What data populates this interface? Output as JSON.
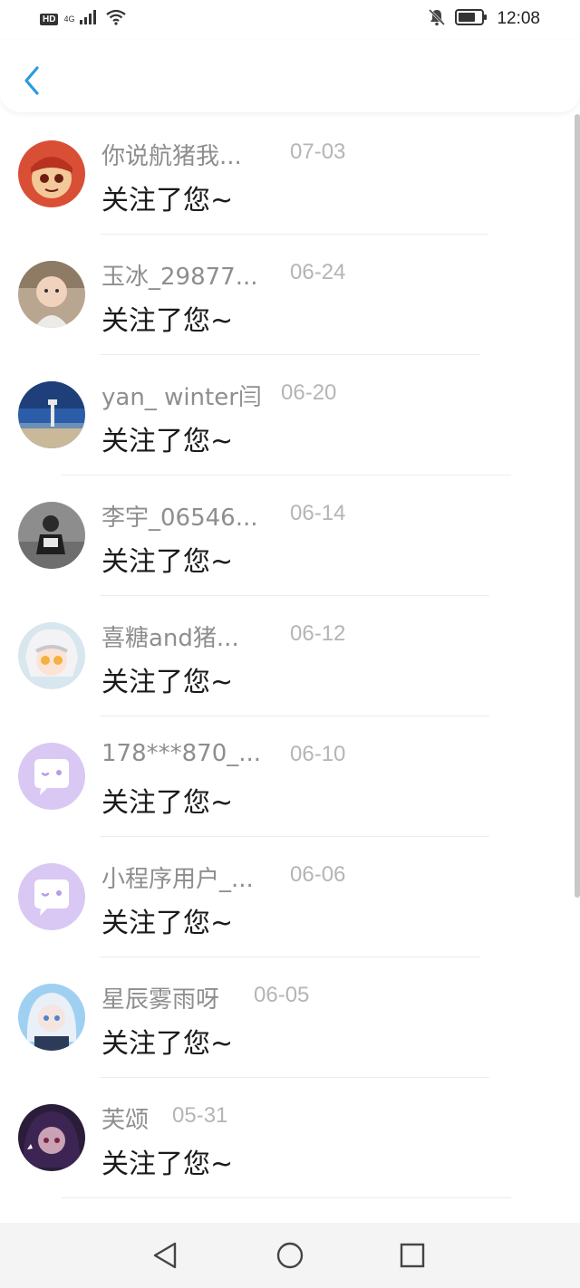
{
  "status_bar": {
    "hd": "HD",
    "network": "4G",
    "time": "12:08"
  },
  "header": {
    "back_icon": "chevron-left-icon",
    "accent": "#2a9ae0"
  },
  "notifications": [
    {
      "name": "你说航猪我...",
      "date": "07-03",
      "message": "关注了您~",
      "avatar": "cartoon-cat"
    },
    {
      "name": "玉冰_29877...",
      "date": "06-24",
      "message": "关注了您~",
      "avatar": "baby-photo"
    },
    {
      "name": "yan_ winter闫",
      "date": "06-20",
      "message": "关注了您~",
      "avatar": "lighthouse-sky"
    },
    {
      "name": "李宇_06546...",
      "date": "06-14",
      "message": "关注了您~",
      "avatar": "person-photo"
    },
    {
      "name": "喜糖and猪...",
      "date": "06-12",
      "message": "关注了您~",
      "avatar": "anime-girl"
    },
    {
      "name": "178***870_...",
      "date": "06-10",
      "message": "关注了您~",
      "avatar": "default-chat"
    },
    {
      "name": "小程序用户_...",
      "date": "06-06",
      "message": "关注了您~",
      "avatar": "default-chat"
    },
    {
      "name": "星辰雾雨呀",
      "date": "06-05",
      "message": "关注了您~",
      "avatar": "anime-blue"
    },
    {
      "name": "芙颂",
      "date": "05-31",
      "message": "关注了您~",
      "avatar": "dark-portrait"
    }
  ],
  "nav": {
    "back": "triangle-back-icon",
    "home": "circle-home-icon",
    "recents": "square-recents-icon"
  }
}
